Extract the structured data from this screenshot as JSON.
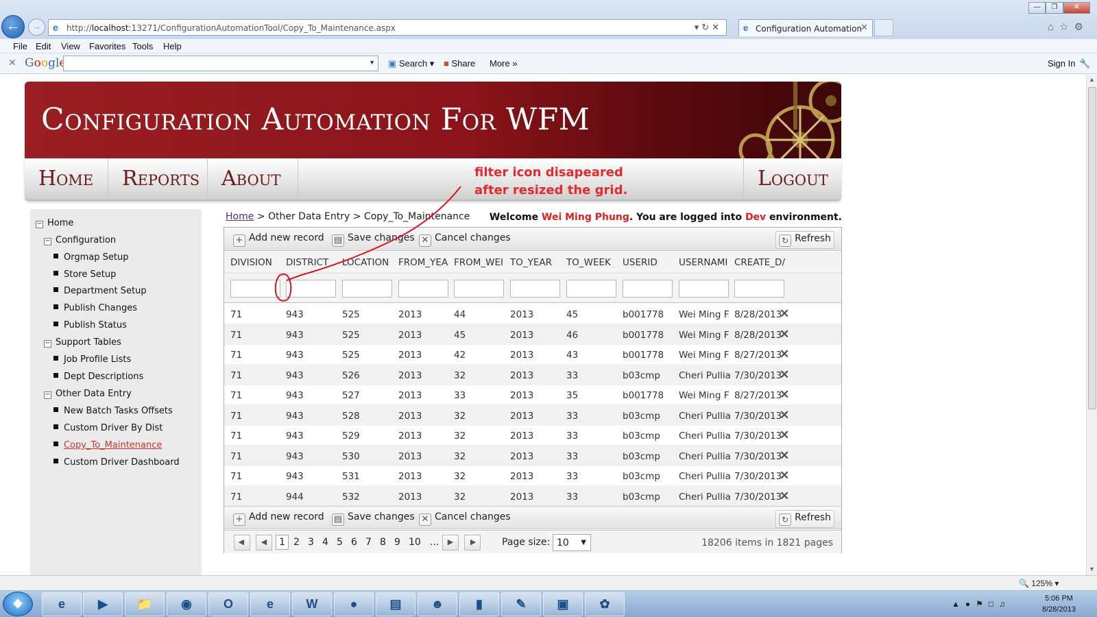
{
  "browser": {
    "url_host": "http://",
    "url_bold": "localhost",
    "url_rest": ":13271/ConfigurationAutomationTool/Copy_To_Maintenance.aspx",
    "tab_title": "Configuration Automation ...",
    "menu": [
      "File",
      "Edit",
      "View",
      "Favorites",
      "Tools",
      "Help"
    ],
    "google": {
      "logo": "Google",
      "search": "Search",
      "share": "Share",
      "more": "More »",
      "sign_in": "Sign In"
    },
    "zoom": "125%"
  },
  "site": {
    "title": "Configuration Automation For WFM",
    "nav": {
      "home": "Home",
      "reports": "Reports",
      "about": "About",
      "logout": "Logout"
    }
  },
  "annotation": {
    "line1": "filter icon disapeared",
    "line2": "after resized the grid."
  },
  "sidebar": {
    "home": "Home",
    "configuration": "Configuration",
    "config_items": [
      "Orgmap Setup",
      "Store Setup",
      "Department Setup",
      "Publish Changes",
      "Publish Status"
    ],
    "support": "Support Tables",
    "support_items": [
      "Job Profile Lists",
      "Dept Descriptions"
    ],
    "other": "Other Data Entry",
    "other_items": [
      "New Batch Tasks Offsets",
      "Custom Driver By Dist",
      "Copy_To_Maintenance",
      "Custom Driver Dashboard"
    ]
  },
  "breadcrumb": {
    "home": "Home",
    "rest": " > Other Data Entry > Copy_To_Maintenance"
  },
  "welcome": {
    "prefix": "Welcome ",
    "user": "Wei Ming Phung",
    "middle": ". You are logged into ",
    "env": "Dev",
    "suffix": " environment."
  },
  "grid": {
    "toolbar": {
      "add": "Add new record",
      "save": "Save changes",
      "cancel": "Cancel changes",
      "refresh": "Refresh"
    },
    "columns": [
      "DIVISION",
      "DISTRICT",
      "LOCATION",
      "FROM_YEA",
      "FROM_WEI",
      "TO_YEAR",
      "TO_WEEK",
      "USERID",
      "USERNAMI",
      "CREATE_D/"
    ],
    "rows": [
      [
        "71",
        "943",
        "525",
        "2013",
        "44",
        "2013",
        "45",
        "b001778",
        "Wei Ming F",
        "8/28/2013"
      ],
      [
        "71",
        "943",
        "525",
        "2013",
        "45",
        "2013",
        "46",
        "b001778",
        "Wei Ming F",
        "8/28/2013"
      ],
      [
        "71",
        "943",
        "525",
        "2013",
        "42",
        "2013",
        "43",
        "b001778",
        "Wei Ming F",
        "8/27/2013"
      ],
      [
        "71",
        "943",
        "526",
        "2013",
        "32",
        "2013",
        "33",
        "b03cmp",
        "Cheri Pullia",
        "7/30/2013"
      ],
      [
        "71",
        "943",
        "527",
        "2013",
        "33",
        "2013",
        "35",
        "b001778",
        "Wei Ming F",
        "8/27/2013"
      ],
      [
        "71",
        "943",
        "528",
        "2013",
        "32",
        "2013",
        "33",
        "b03cmp",
        "Cheri Pullia",
        "7/30/2013"
      ],
      [
        "71",
        "943",
        "529",
        "2013",
        "32",
        "2013",
        "33",
        "b03cmp",
        "Cheri Pullia",
        "7/30/2013"
      ],
      [
        "71",
        "943",
        "530",
        "2013",
        "32",
        "2013",
        "33",
        "b03cmp",
        "Cheri Pullia",
        "7/30/2013"
      ],
      [
        "71",
        "943",
        "531",
        "2013",
        "32",
        "2013",
        "33",
        "b03cmp",
        "Cheri Pullia",
        "7/30/2013"
      ],
      [
        "71",
        "944",
        "532",
        "2013",
        "32",
        "2013",
        "33",
        "b03cmp",
        "Cheri Pullia",
        "7/30/2013"
      ]
    ],
    "pager": {
      "pages": [
        "1",
        "2",
        "3",
        "4",
        "5",
        "6",
        "7",
        "8",
        "9",
        "10",
        "..."
      ],
      "current": "1",
      "page_size_label": "Page size:",
      "page_size": "10",
      "info": "18206 items in 1821 pages"
    }
  },
  "taskbar": {
    "time": "5:06 PM",
    "date": "8/28/2013"
  }
}
